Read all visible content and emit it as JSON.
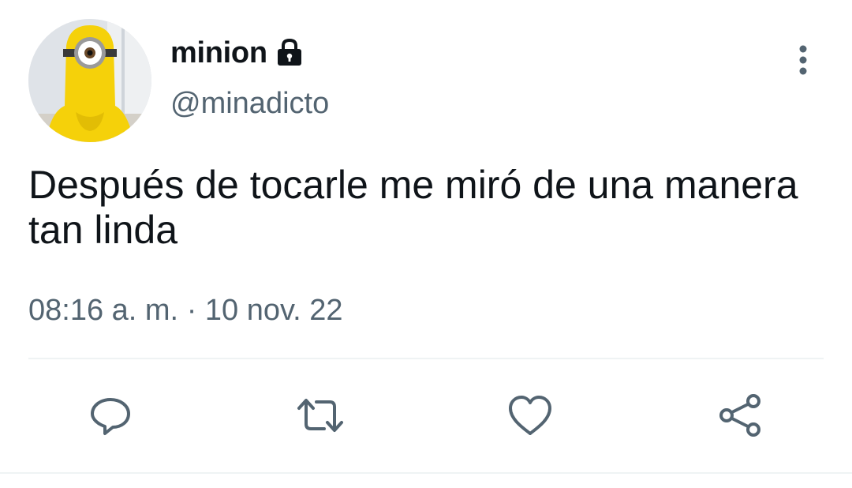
{
  "user": {
    "display_name": "minion",
    "handle": "@minadicto",
    "protected": true
  },
  "tweet": {
    "text": "Después de tocarle me miró de una manera tan linda",
    "time": "08:16 a. m.",
    "separator": "·",
    "date": "10 nov. 22"
  },
  "icons": {
    "lock": "lock-icon",
    "more": "more-vertical-icon",
    "reply": "reply-icon",
    "retweet": "retweet-icon",
    "like": "heart-icon",
    "share": "share-icon"
  },
  "colors": {
    "text_primary": "#0f1419",
    "text_secondary": "#536471",
    "icon_gray": "#536471",
    "divider": "#eff3f4",
    "avatar_yellow": "#f5d10a"
  }
}
